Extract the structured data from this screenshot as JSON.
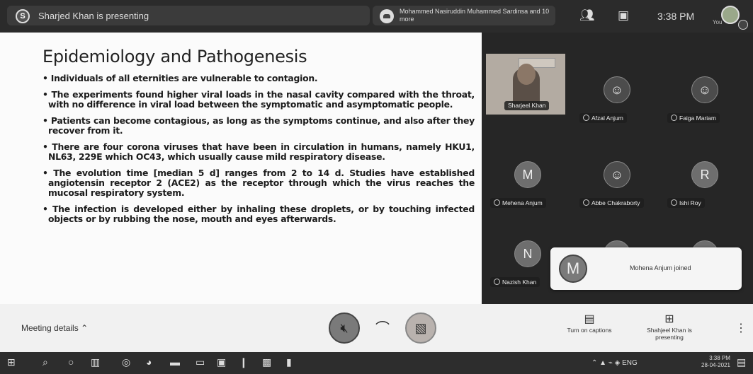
{
  "top_bar": {
    "presenting_initial": "S",
    "presenting_text": "Sharjed Khan is presenting",
    "viewers_text": "Mohammed Nasiruddin Muhammed Sardinsa and 10 more",
    "time": "3:38 PM",
    "you_label": "You",
    "icons": [
      "people-icon",
      "chat-icon"
    ]
  },
  "slide": {
    "title": "Epidemiology and Pathogenesis",
    "bullets": [
      "Individuals of all eternities are vulnerable to contagion.",
      "The experiments found higher viral loads in the nasal cavity compared with the throat, with no difference in viral load between the symptomatic and asymptomatic people.",
      "Patients can become contagious, as long as the symptoms continue, and also after they recover from it.",
      "There are four corona viruses that have been in circulation in humans, namely HKU1, NL63, 229E which OC43, which usually cause mild respiratory disease.",
      "The evolution time [median 5 d] ranges from 2 to 14 d. Studies have established angiotensin receptor 2 (ACE2) as the receptor through which the virus reaches the mucosal respiratory system.",
      "The infection is developed either by inhaling these droplets, or by touching infected objects or by rubbing the nose, mouth and eyes afterwards."
    ]
  },
  "participants": [
    {
      "name": "Sharjeel Khan",
      "initial": "",
      "video": true
    },
    {
      "name": "Afzal Anjum",
      "initial": "",
      "video": false
    },
    {
      "name": "Faiga Mariam",
      "initial": "",
      "video": false
    },
    {
      "name": "Mehena Anjum",
      "initial": "M",
      "video": false
    },
    {
      "name": "Abbe Chakraborty",
      "initial": "",
      "video": false
    },
    {
      "name": "Ishi Roy",
      "initial": "R",
      "video": false
    },
    {
      "name": "Nazish Khan",
      "initial": "N",
      "video": false
    },
    {
      "name": "",
      "initial": "S",
      "video": false
    },
    {
      "name": "",
      "initial": "R",
      "video": false
    }
  ],
  "toast": {
    "initial": "M",
    "text": "Mohena Anjum joined"
  },
  "controls": {
    "meeting_details": "Meeting details",
    "captions": "Turn on captions",
    "present": "Shahjeel Khan is presenting"
  },
  "taskbar": {
    "icons": [
      "start-icon",
      "search-icon",
      "cortana-icon",
      "task-view-icon",
      "chrome-icon",
      "app-icon",
      "mail-icon",
      "folder-icon",
      "store-icon",
      "app2-icon",
      "photos-icon",
      "terminal-icon"
    ],
    "tray_lang": "ENG",
    "time": "3:38 PM",
    "date": "28-04-2021"
  },
  "colors": {
    "topbar": "#2b2b2b",
    "panel": "#262626",
    "slide": "#fbfbfb"
  }
}
